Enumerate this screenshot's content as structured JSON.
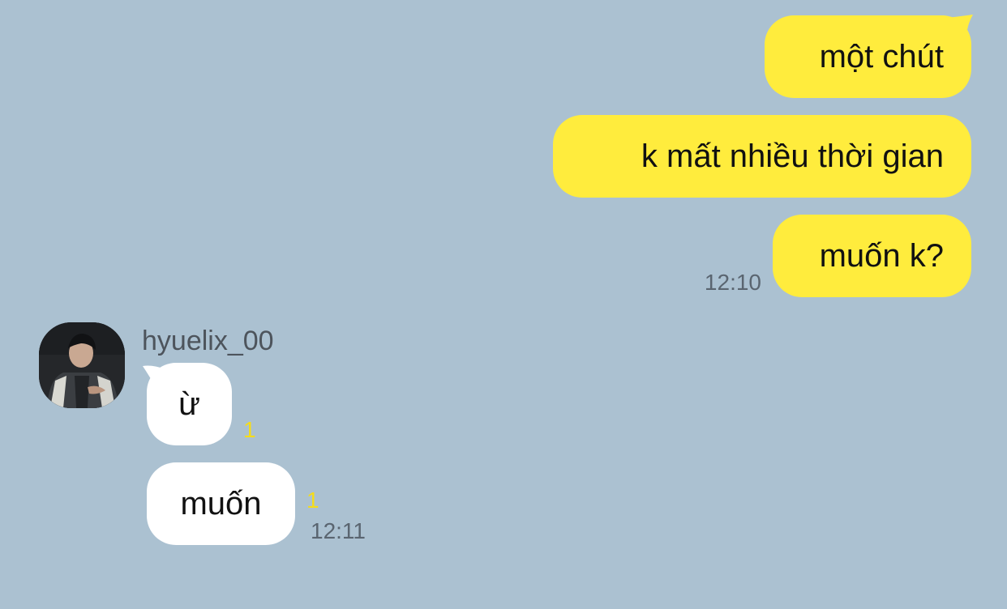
{
  "chat": {
    "outgoing": [
      {
        "text": "một chút"
      },
      {
        "text": "k mất nhiều thời gian"
      },
      {
        "text": "muốn k?",
        "time": "12:10"
      }
    ],
    "sender": {
      "name": "hyuelix_00",
      "avatar": "profile-photo"
    },
    "incoming": [
      {
        "text": "ừ",
        "unread": "1"
      },
      {
        "text": "muốn",
        "unread": "1",
        "time": "12:11"
      }
    ]
  },
  "colors": {
    "background": "#abc1d1",
    "outgoing_bubble": "#ffec3d",
    "incoming_bubble": "#ffffff",
    "unread": "#f5dc1a",
    "time": "#5a6570"
  }
}
